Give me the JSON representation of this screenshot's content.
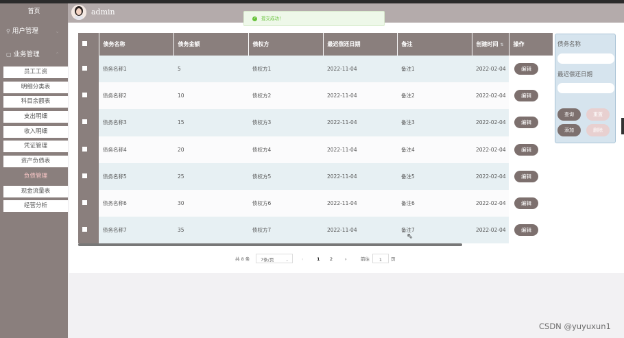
{
  "header": {
    "username": "admin"
  },
  "toast": {
    "message": "提交成功！"
  },
  "sidebar": {
    "home": "首页",
    "groups": [
      {
        "label": "用户管理"
      },
      {
        "label": "业务管理"
      }
    ],
    "items": [
      {
        "label": "员工工资"
      },
      {
        "label": "明细分类表"
      },
      {
        "label": "科目余额表"
      },
      {
        "label": "支出明细"
      },
      {
        "label": "收入明细"
      },
      {
        "label": "凭证管理"
      },
      {
        "label": "资产负债表"
      },
      {
        "label": "负债管理",
        "active": true
      },
      {
        "label": "现金流量表"
      },
      {
        "label": "经营分析"
      }
    ]
  },
  "table": {
    "columns": [
      "债务名称",
      "债务金额",
      "债权方",
      "最迟偿还日期",
      "备注",
      "创建时间",
      "操作"
    ],
    "rows": [
      {
        "name": "债务名称1",
        "amount": "5",
        "creditor": "债权方1",
        "due": "2022-11-04",
        "note": "备注1",
        "created": "2022-02-04",
        "action": "编辑"
      },
      {
        "name": "债务名称2",
        "amount": "10",
        "creditor": "债权方2",
        "due": "2022-11-04",
        "note": "备注2",
        "created": "2022-02-04",
        "action": "编辑"
      },
      {
        "name": "债务名称3",
        "amount": "15",
        "creditor": "债权方3",
        "due": "2022-11-04",
        "note": "备注3",
        "created": "2022-02-04",
        "action": "编辑"
      },
      {
        "name": "债务名称4",
        "amount": "20",
        "creditor": "债权方4",
        "due": "2022-11-04",
        "note": "备注4",
        "created": "2022-02-04",
        "action": "编辑"
      },
      {
        "name": "债务名称5",
        "amount": "25",
        "creditor": "债权方5",
        "due": "2022-11-04",
        "note": "备注5",
        "created": "2022-02-04",
        "action": "编辑"
      },
      {
        "name": "债务名称6",
        "amount": "30",
        "creditor": "债权方6",
        "due": "2022-11-04",
        "note": "备注6",
        "created": "2022-02-04",
        "action": "编辑"
      },
      {
        "name": "债务名称7",
        "amount": "35",
        "creditor": "债权方7",
        "due": "2022-11-04",
        "note": "备注7",
        "created": "2022-02-04",
        "action": "编辑"
      }
    ]
  },
  "pagination": {
    "total": "共 8 条",
    "page_size": "7条/页",
    "pages": [
      "1",
      "2"
    ],
    "goto_label": "前往",
    "goto_value": "1",
    "page_suffix": "页",
    "prev": "‹",
    "next": "›"
  },
  "search_panel": {
    "name_label": "债务名称",
    "date_label": "最迟偿还日期",
    "query_button": "查询",
    "reset_button": "重置",
    "add_button": "添加",
    "delete_button": "删除"
  },
  "watermark": "CSDN @yuyuxun1"
}
